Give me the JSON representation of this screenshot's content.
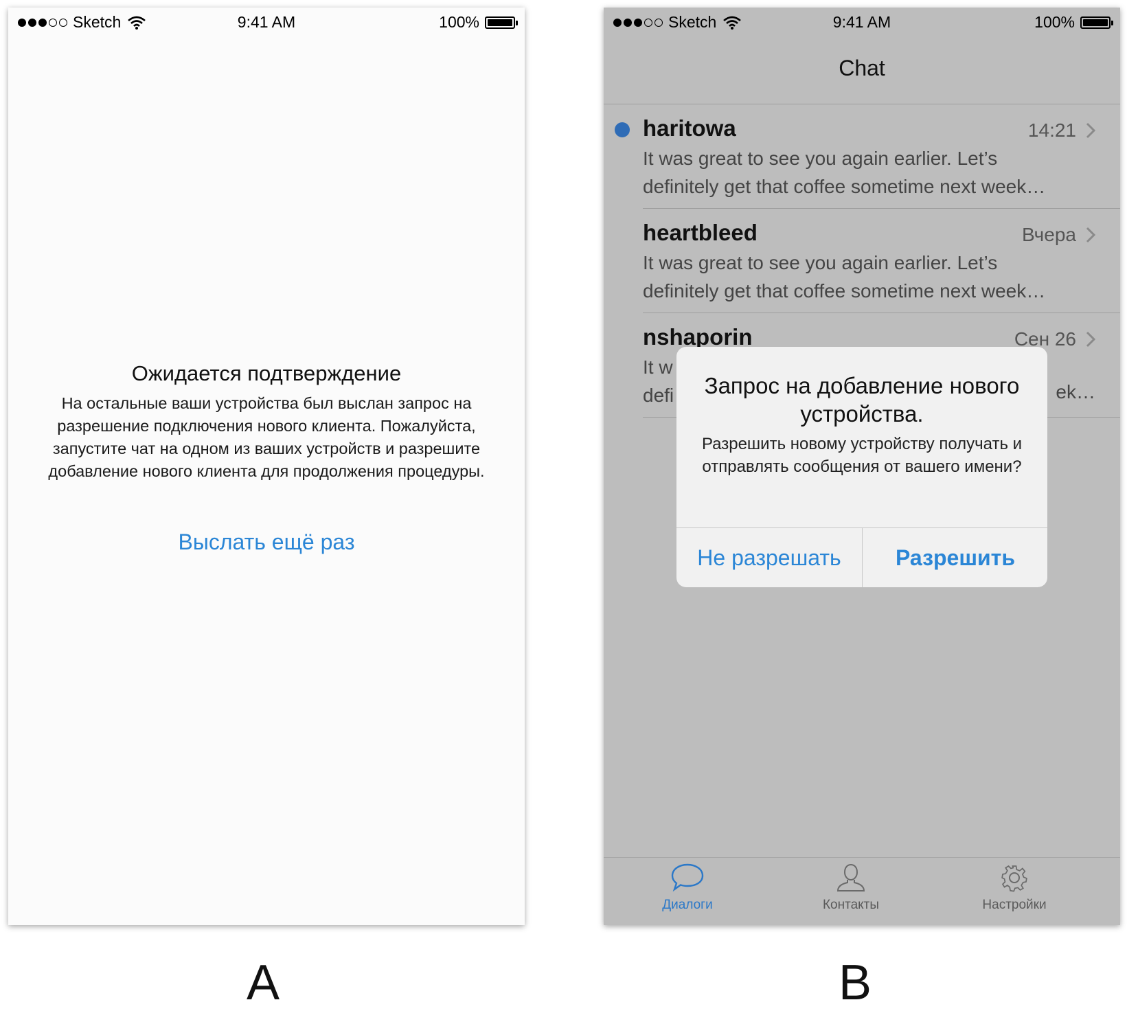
{
  "status_bar": {
    "carrier": "Sketch",
    "time": "9:41 AM",
    "battery": "100%"
  },
  "screen_a": {
    "title": "Ожидается подтверждение",
    "body": "На остальные ваши устройства был выслан запрос на разрешение подключения нового клиента. Пожалуйста, запустите чат на одном из ваших устройств и разрешите добавление нового клиента для продолжения процедуры.",
    "resend_link": "Выслать ещё раз",
    "link_color": "#2b86d6"
  },
  "screen_b": {
    "nav_title": "Chat",
    "chats": [
      {
        "name": "haritowa",
        "time": "14:21",
        "unread": true,
        "preview_line1": "It was great to see you again earlier. Let’s",
        "preview_line2": "definitely get that coffee sometime next week…"
      },
      {
        "name": "heartbleed",
        "time": "Вчера",
        "unread": false,
        "preview_line1": "It was great to see you again earlier. Let’s",
        "preview_line2": "definitely get that coffee sometime next week…"
      },
      {
        "name": "nshaporin",
        "time": "Сен 26",
        "unread": false,
        "preview_line1": "It w",
        "preview_line2": "defi",
        "preview_line2_tail": "ek…"
      }
    ],
    "alert": {
      "title": "Запрос на добавление нового устройства.",
      "message": "Разрешить новому устройству получать и отправлять сообщения от вашего имени?",
      "deny_button": "Не разрешать",
      "allow_button": "Разрешить"
    },
    "tabs": [
      {
        "label": "Диалоги",
        "icon": "chat-bubble-icon",
        "active": true
      },
      {
        "label": "Контакты",
        "icon": "person-icon",
        "active": false
      },
      {
        "label": "Настройки",
        "icon": "gear-icon",
        "active": false
      }
    ],
    "unread_color": "#2f6cb6",
    "dim_background": "#bdbdbd"
  },
  "captions": {
    "left": "A",
    "right": "B"
  }
}
